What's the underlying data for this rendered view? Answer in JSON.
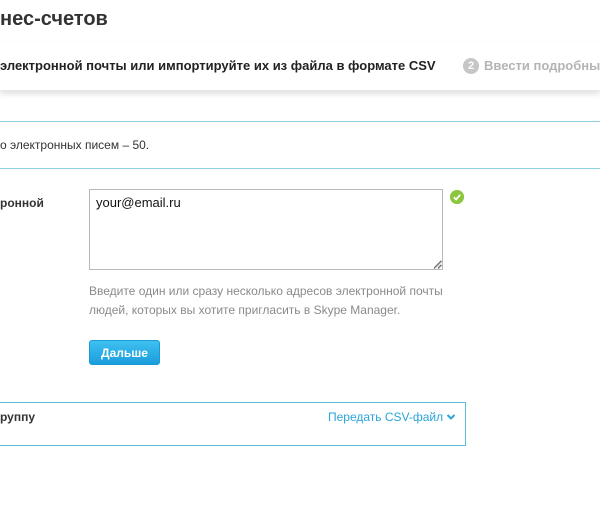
{
  "header": {
    "title": "нес-счетов"
  },
  "steps": {
    "current_label": "электронной почты или импортируйте их из файла в формате CSV",
    "next_number": "2",
    "next_label": "Ввести подробны"
  },
  "notice": {
    "text": "о электронных писем – 50."
  },
  "email": {
    "label": "ронной",
    "value": "your@email.ru",
    "valid": true,
    "help_text": "Введите один или сразу несколько адресов электронной почты людей, которых вы хотите пригласить в Skype Manager."
  },
  "actions": {
    "next_label": "Дальше"
  },
  "group": {
    "label": "руппу",
    "csv_link": "Передать CSV-файл"
  },
  "colors": {
    "accent": "#2aa5d8",
    "button": "#1a9ede",
    "valid": "#8cc63f",
    "rule": "#8ed0de"
  },
  "icons": {
    "valid": "check-circle-icon",
    "expand": "chevron-down-icon",
    "step": "step-number-badge"
  }
}
